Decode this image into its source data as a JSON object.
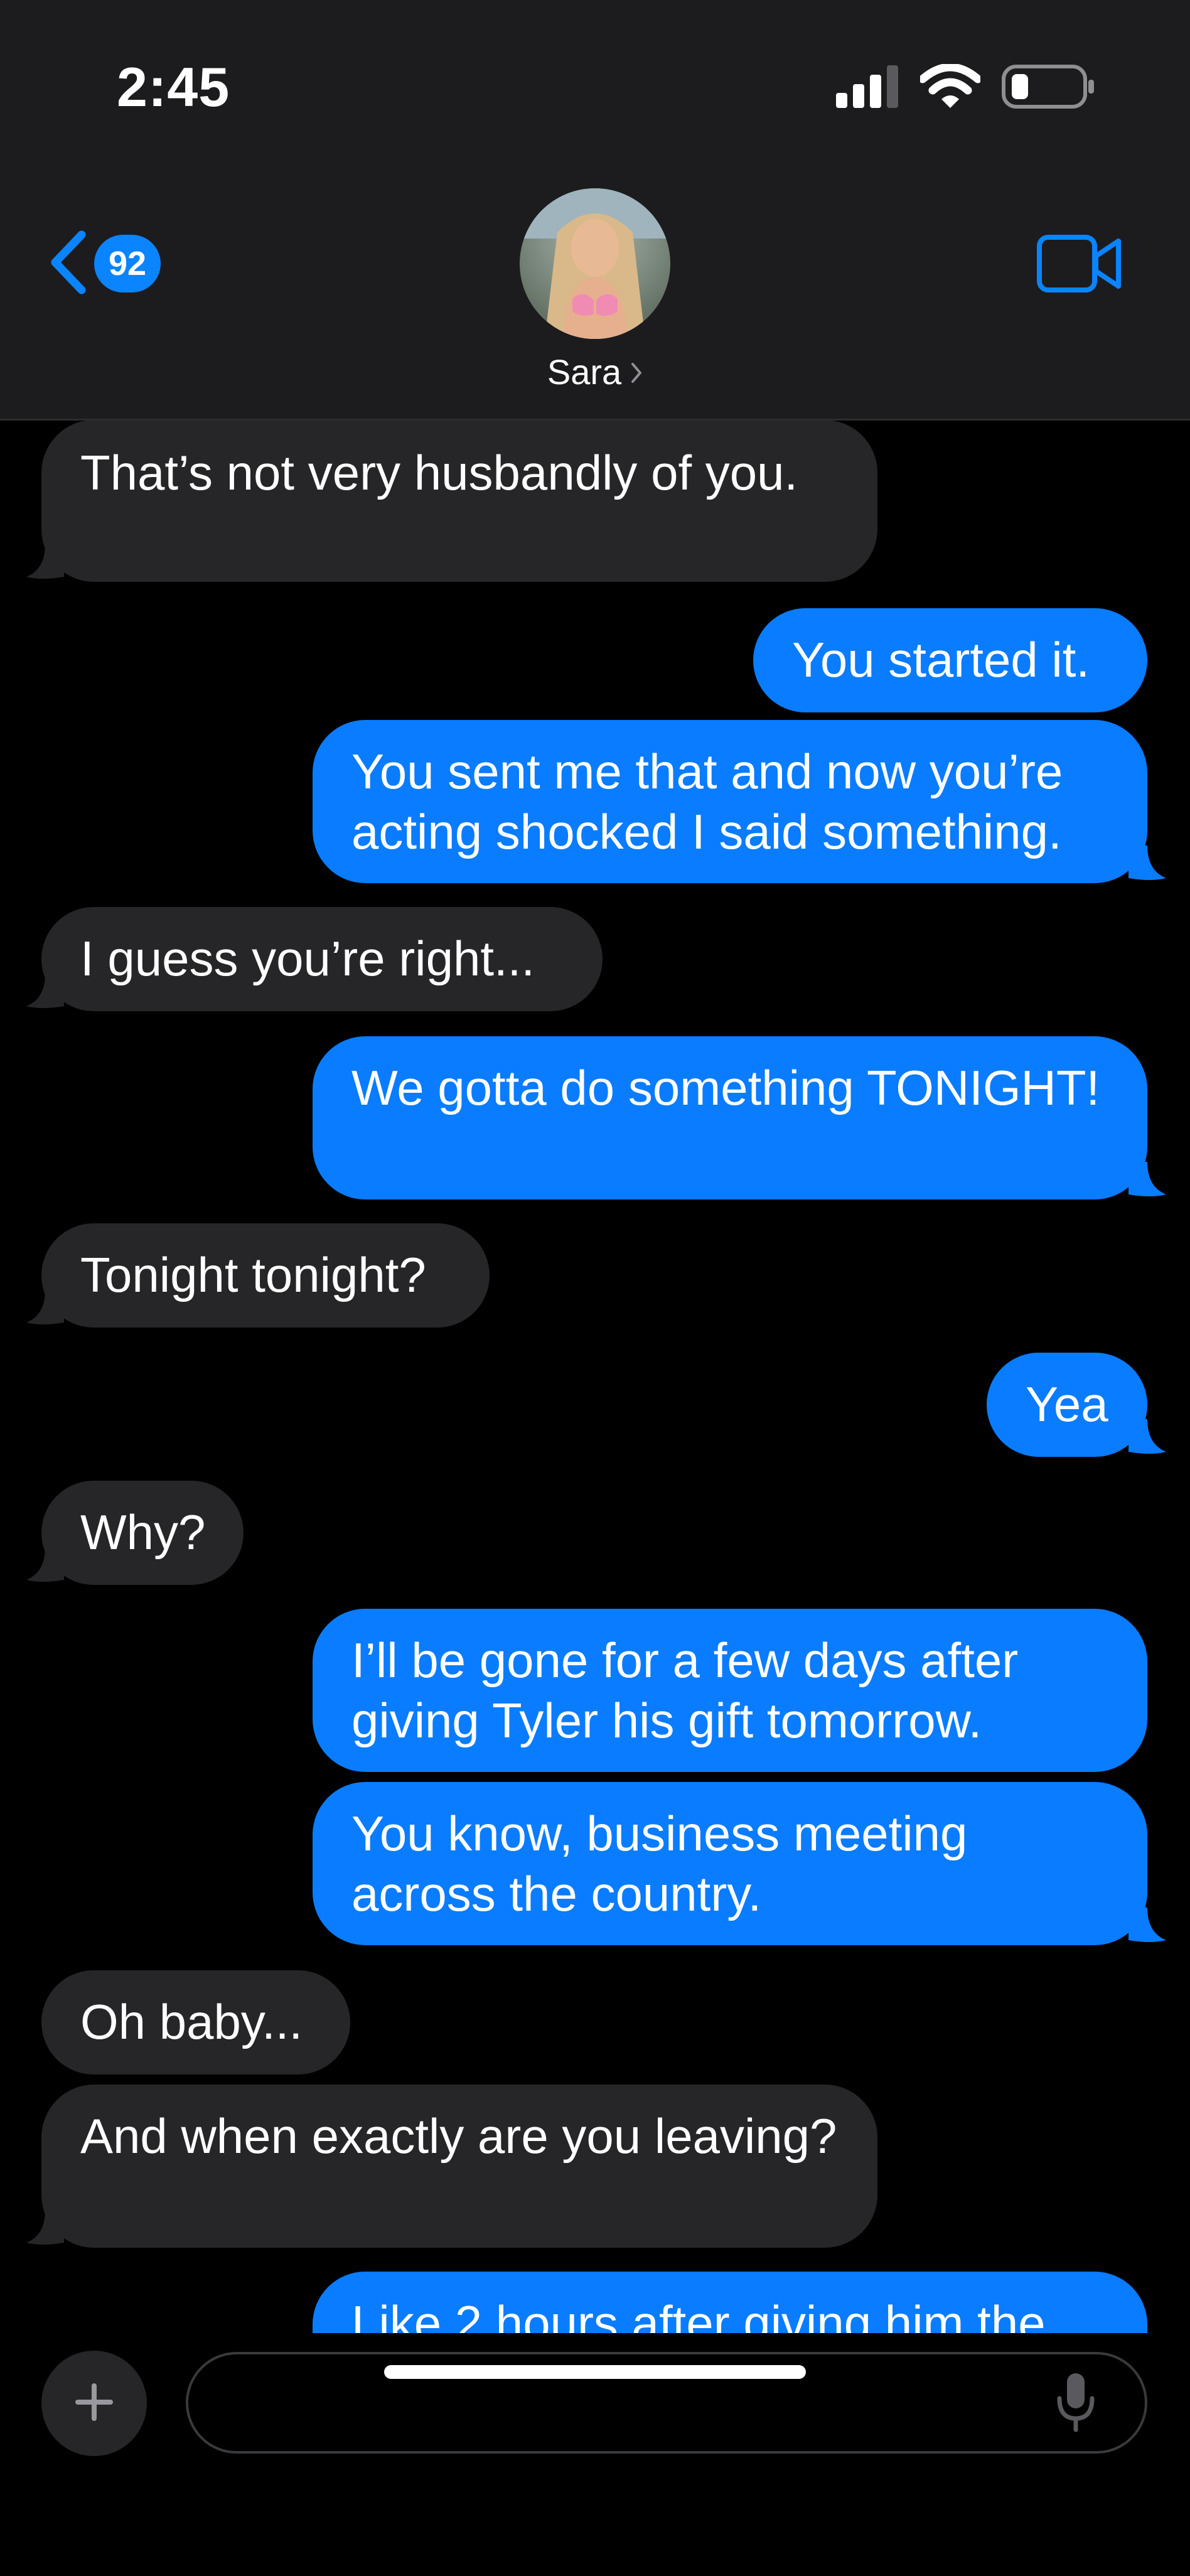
{
  "status_bar": {
    "time": "2:45",
    "icons": [
      "cellular-signal-icon",
      "wifi-icon",
      "battery-icon"
    ]
  },
  "header": {
    "back_badge": "92",
    "contact_name": "Sara",
    "icons": [
      "chevron-left-icon",
      "chevron-right-icon",
      "video-camera-icon"
    ]
  },
  "messages": [
    {
      "from": "in",
      "text": "That’s not very husbandly of you."
    },
    {
      "from": "out",
      "text": "You started it."
    },
    {
      "from": "out",
      "text": "You sent me that and now you’re acting shocked I said something."
    },
    {
      "from": "in",
      "text": "I guess you’re right..."
    },
    {
      "from": "out",
      "text": "We gotta do something TONIGHT!"
    },
    {
      "from": "in",
      "text": "Tonight tonight?"
    },
    {
      "from": "out",
      "text": "Yea"
    },
    {
      "from": "in",
      "text": "Why?"
    },
    {
      "from": "out",
      "text": "I’ll be gone for a few days after giving Tyler his gift tomorrow."
    },
    {
      "from": "out",
      "text": "You know, business meeting across the country."
    },
    {
      "from": "in",
      "text": "Oh baby..."
    },
    {
      "from": "in",
      "text": "And when exactly are you leaving?"
    },
    {
      "from": "out",
      "text": "Like 2 hours after giving him the"
    }
  ],
  "input_bar": {
    "value": "",
    "icons": [
      "plus-icon",
      "microphone-icon"
    ]
  },
  "colors": {
    "header_bg": "#1c1c1e",
    "incoming_bubble": "#262628",
    "outgoing_bubble": "#0a7cff",
    "accent": "#0a84ff",
    "background": "#000000"
  }
}
